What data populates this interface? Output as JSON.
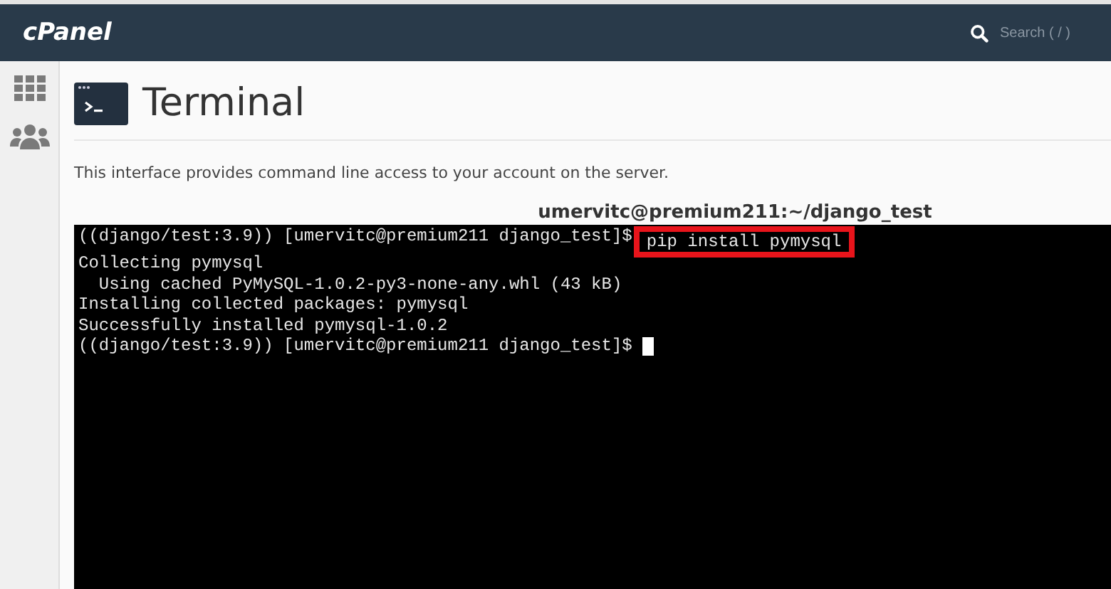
{
  "header": {
    "logo": "cPanel",
    "search": {
      "placeholder": "Search ( / )"
    }
  },
  "page": {
    "title": "Terminal",
    "description": "This interface provides command line access to your account on the server."
  },
  "terminal": {
    "title": "umervitc@premium211:~/django_test",
    "lines": [
      {
        "kind": "marked_command",
        "prompt": "((django/test:3.9)) [umervitc@premium211 django_test]$",
        "command": "pip install pymysql"
      },
      {
        "kind": "output",
        "text": "Collecting pymysql"
      },
      {
        "kind": "output",
        "text": "  Using cached PyMySQL-1.0.2-py3-none-any.whl (43 kB)"
      },
      {
        "kind": "output",
        "text": "Installing collected packages: pymysql"
      },
      {
        "kind": "output",
        "text": "Successfully installed pymysql-1.0.2"
      },
      {
        "kind": "active_prompt",
        "prompt": "((django/test:3.9)) [umervitc@premium211 django_test]$"
      }
    ]
  }
}
